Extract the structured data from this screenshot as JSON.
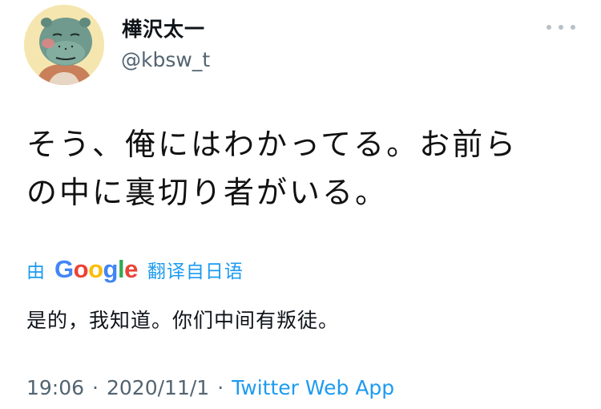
{
  "author": {
    "display_name": "樺沢太一",
    "handle": "@kbsw_t"
  },
  "tweet": {
    "text_line_1": "そう、俺にはわかってる。お前ら",
    "text_line_2": "の中に裏切り者がいる。"
  },
  "translation": {
    "by_label": "由",
    "provider": "Google",
    "action_label": "翻译自日语",
    "translated_text": "是的，我知道。你们中间有叛徒。",
    "logo_colors": [
      "#4285F4",
      "#EA4335",
      "#FBBC05",
      "#4285F4",
      "#34A853",
      "#EA4335"
    ]
  },
  "meta": {
    "time": "19:06",
    "separator": "·",
    "date": "2020/11/1",
    "source": "Twitter Web App"
  },
  "icons": {
    "more": "more-horizontal-icon",
    "avatar": "hippo-character-avatar"
  },
  "colors": {
    "link": "#1d9bf0",
    "secondary_text": "#536471"
  }
}
